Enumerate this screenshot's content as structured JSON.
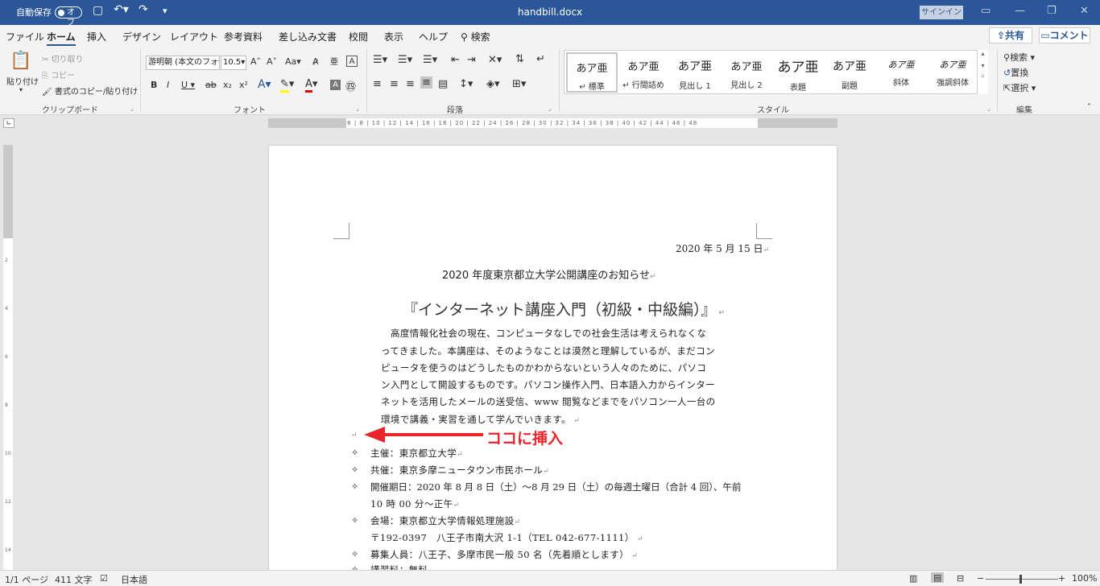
{
  "titlebar": {
    "autosave_label": "自動保存",
    "autosave_state": "オフ",
    "save_icon": "save-icon",
    "doc_name": "handbill.docx",
    "signin": "サインイン"
  },
  "menu": {
    "items": [
      "ファイル",
      "ホーム",
      "挿入",
      "デザイン",
      "レイアウト",
      "参考資料",
      "差し込み文書",
      "校閲",
      "表示",
      "ヘルプ"
    ],
    "search": "検索",
    "share": "共有",
    "comment": "コメント"
  },
  "ribbon": {
    "clipboard": {
      "paste": "貼り付け",
      "cut": "切り取り",
      "copy": "コピー",
      "format_painter": "書式のコピー/貼り付け",
      "label": "クリップボード"
    },
    "font": {
      "name": "游明朝 (本文のフォ",
      "size": "10.5",
      "label": "フォント"
    },
    "paragraph": {
      "label": "段落"
    },
    "styles": {
      "label": "スタイル",
      "items": [
        {
          "preview": "あア亜",
          "name": "↵ 標準"
        },
        {
          "preview": "あア亜",
          "name": "↵ 行間詰め"
        },
        {
          "preview": "あア亜",
          "name": "見出し 1"
        },
        {
          "preview": "あア亜",
          "name": "見出し 2"
        },
        {
          "preview": "あア亜",
          "name": "表題"
        },
        {
          "preview": "あア亜",
          "name": "副題"
        },
        {
          "preview": "あア亜",
          "name": "斜体"
        },
        {
          "preview": "あア亜",
          "name": "強調斜体"
        }
      ]
    },
    "editing": {
      "find": "検索",
      "replace": "置換",
      "select": "選択",
      "label": "編集"
    }
  },
  "ruler": {
    "marks": "8 | 6 | 4 | 2 |  | 2 | 4 | 6 | 8 | 10 | 12 | 14 | 16 | 18 | 20 | 22 | 24 | 26 | 28 | 30 | 32 | 34 | 36 | 38 | 40 | 42 | 44 | 46 | 48"
  },
  "document": {
    "date": "2020 年 5 月 15 日",
    "subtitle": "2020 年度東京都立大学公開講座のお知らせ",
    "title": "『インターネット講座入門（初級・中級編）』",
    "body": [
      "高度情報化社会の現在、コンピュータなしでの社会生活は考えられなくな",
      "ってきました。本講座は、そのようなことは漠然と理解しているが、まだコン",
      "ピュータを使うのはどうしたものかわからないという人々のために、パソコ",
      "ン入門として開設するものです。パソコン操作入門、日本語入力からインター",
      "ネットを活用したメールの送受信、www 閲覧などまでをパソコン一人一台の",
      "環境で講義・実習を通して学んでいきます。"
    ],
    "bullets": [
      "主催：東京都立大学",
      "共催：東京多摩ニュータウン市民ホール",
      "開催期日：2020 年 8 月 8 日（土）～8 月 29 日（土）の毎週土曜日（合計 4 回）、午前",
      "10 時 00 分～正午",
      "会場：東京都立大学情報処理施設",
      "〒192-0397　八王子市南大沢 1-1（TEL 042-677-1111）",
      "募集人員：八王子、多摩市民一般 50 名（先着順とします）",
      "講習料：無料"
    ]
  },
  "annotation": {
    "text": "ココに挿入",
    "color": "#e8262a"
  },
  "status": {
    "page": "1/1 ページ",
    "words": "411 文字",
    "language": "日本語",
    "zoom": "100%"
  },
  "colors": {
    "brand": "#2b579a"
  }
}
